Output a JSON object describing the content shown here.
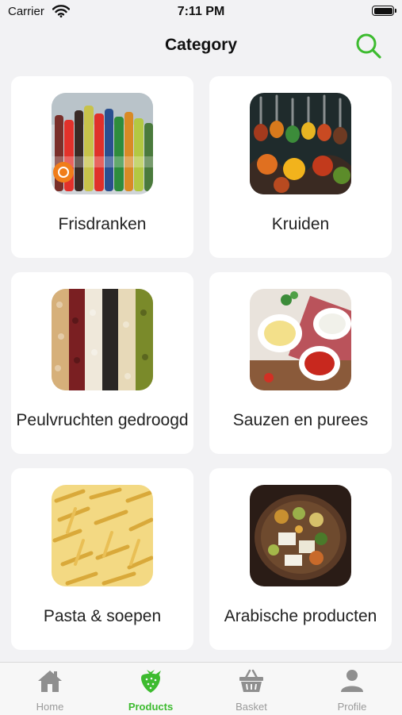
{
  "status_bar": {
    "carrier": "Carrier",
    "time": "7:11 PM"
  },
  "header": {
    "title": "Category",
    "search_icon": "search-icon"
  },
  "colors": {
    "accent": "#3dbb2f",
    "background": "#f2f2f4",
    "inactive": "#9a9a9a"
  },
  "categories": [
    {
      "label": "Frisdranken",
      "image": "soft-drinks-image"
    },
    {
      "label": "Kruiden",
      "image": "spices-image"
    },
    {
      "label": "Peulvruchten gedroogd",
      "image": "dried-legumes-image"
    },
    {
      "label": "Sauzen en purees",
      "image": "sauces-image"
    },
    {
      "label": "Pasta & soepen",
      "image": "pasta-image"
    },
    {
      "label": "Arabische producten",
      "image": "arabic-products-image"
    }
  ],
  "tabbar": {
    "active": "Products",
    "items": [
      {
        "label": "Home",
        "icon": "home-icon"
      },
      {
        "label": "Products",
        "icon": "strawberry-icon"
      },
      {
        "label": "Basket",
        "icon": "basket-icon"
      },
      {
        "label": "Profile",
        "icon": "person-icon"
      }
    ]
  }
}
